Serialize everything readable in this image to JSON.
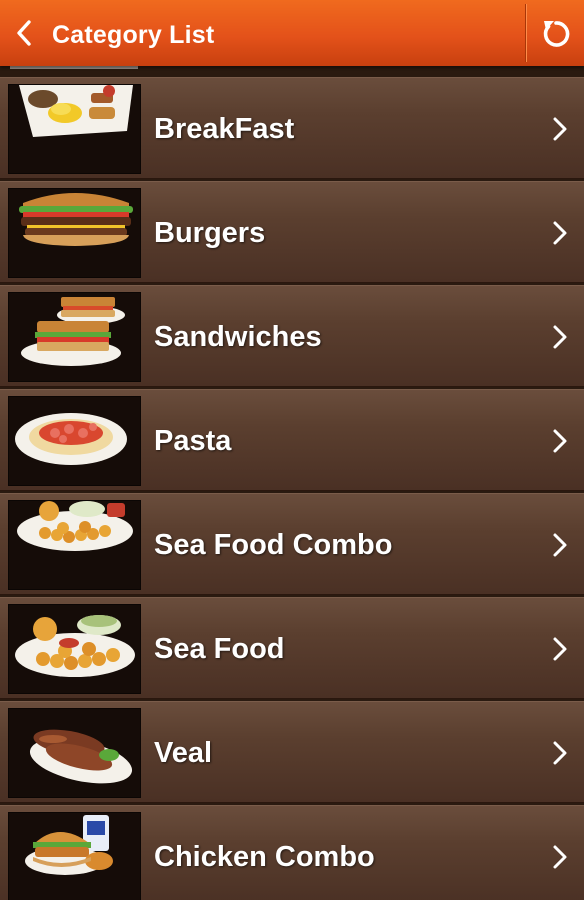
{
  "header": {
    "title": "Category List",
    "back_icon": "chevron-left-icon",
    "refresh_icon": "refresh-icon"
  },
  "colors": {
    "accent": "#e4521a",
    "row_background": "#5b3f2f",
    "text": "#ffffff"
  },
  "categories": [
    {
      "label": "BreakFast",
      "icon": "breakfast-plate-image"
    },
    {
      "label": "Burgers",
      "icon": "burger-image"
    },
    {
      "label": "Sandwiches",
      "icon": "sandwich-image"
    },
    {
      "label": "Pasta",
      "icon": "pasta-image"
    },
    {
      "label": "Sea Food Combo",
      "icon": "seafood-combo-image"
    },
    {
      "label": "Sea Food",
      "icon": "seafood-image"
    },
    {
      "label": "Veal",
      "icon": "veal-image"
    },
    {
      "label": "Chicken Combo",
      "icon": "chicken-combo-image"
    }
  ]
}
